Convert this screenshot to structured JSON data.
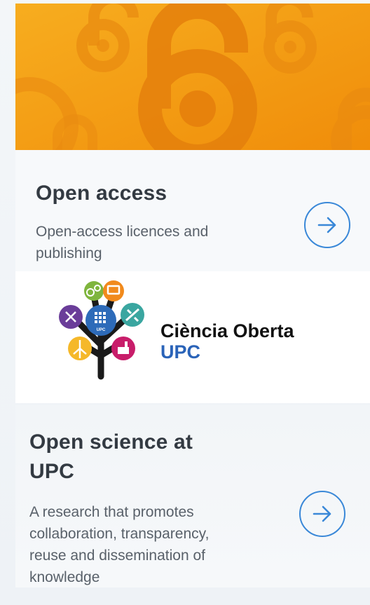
{
  "cards": [
    {
      "title": "Open access",
      "description_lines": [
        "Open-access licences and",
        "publishing"
      ],
      "banner_colors": [
        "#f6a313",
        "#f2900b"
      ],
      "banner_icon": "open-access-lock-icon",
      "arrow_icon": "arrow-right-icon"
    },
    {
      "logo_title": "Ciència Oberta",
      "logo_subtitle": "UPC",
      "tree_badge_text": "UPC",
      "logo_icon": "ciencia-oberta-tree-logo"
    },
    {
      "title_lines": [
        "Open science at",
        "UPC"
      ],
      "description_lines": [
        "A research that promotes",
        "collaboration, transparency,",
        "reuse and dissemination of",
        "knowledge"
      ],
      "arrow_icon": "arrow-right-icon"
    }
  ],
  "colors": {
    "accent_blue": "#3a88d8",
    "banner_orange": "#f49a0c",
    "title_text": "#333a42",
    "body_text": "#59616a",
    "logo_blue": "#2a63b8"
  }
}
